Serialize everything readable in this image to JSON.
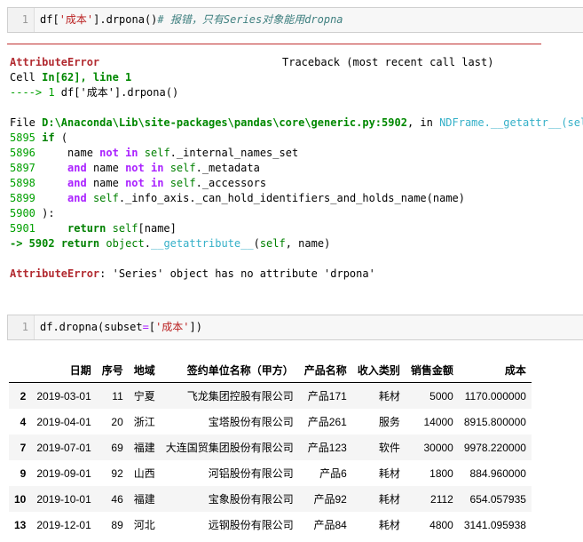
{
  "cell1": {
    "line_number": "1",
    "code_prefix": "df[",
    "code_string": "'成本'",
    "code_call": "].drpona()",
    "code_comment": "# 报错，只有Series对象能用dropna"
  },
  "traceback": {
    "error_name": "AttributeError",
    "traceback_header": "Traceback (most recent call last)",
    "cell_label": "Cell ",
    "cell_ref": "In[62], line 1",
    "arrow_line": "----> 1",
    "arrow_code": " df['成本'].drpona()",
    "file_prefix": "File ",
    "file_path": "D:\\Anaconda\\Lib\\site-packages\\pandas\\core\\generic.py:5902",
    "file_in": ", in ",
    "file_func": "NDFrame.__getattr__(self, name)",
    "lines": [
      {
        "num": "5895",
        "text": " if ("
      },
      {
        "num": "5896",
        "text": "     name not in self._internal_names_set"
      },
      {
        "num": "5897",
        "text": "     and name not in self._metadata"
      },
      {
        "num": "5898",
        "text": "     and name not in self._accessors"
      },
      {
        "num": "5899",
        "text": "     and self._info_axis._can_hold_identifiers_and_holds_name(name)"
      },
      {
        "num": "5900",
        "text": " ):"
      },
      {
        "num": "5901",
        "text": "     return self[name]"
      }
    ],
    "current_arrow": "-> 5902",
    "current_code": " return object.__getattribute__(self, name)",
    "final_error": "AttributeError",
    "final_message": ": 'Series' object has no attribute 'drpona'"
  },
  "cell2": {
    "line_number": "1",
    "code_prefix": "df.dropna(subset",
    "code_eq": "=",
    "code_rest_open": "[",
    "code_string": "'成本'",
    "code_rest_close": "])"
  },
  "table": {
    "columns": [
      "",
      "日期",
      "序号",
      "地域",
      "签约单位名称（甲方）",
      "产品名称",
      "收入类别",
      "销售金额",
      "成本"
    ],
    "rows": [
      [
        "2",
        "2019-03-01",
        "11",
        "宁夏",
        "飞龙集团控股有限公司",
        "产品171",
        "耗材",
        "5000",
        "1170.000000"
      ],
      [
        "4",
        "2019-04-01",
        "20",
        "浙江",
        "宝塔股份有限公司",
        "产品261",
        "服务",
        "14000",
        "8915.800000"
      ],
      [
        "7",
        "2019-07-01",
        "69",
        "福建",
        "大连国贸集团股份有限公司",
        "产品123",
        "软件",
        "30000",
        "9978.220000"
      ],
      [
        "9",
        "2019-09-01",
        "92",
        "山西",
        "河铝股份有限公司",
        "产品6",
        "耗材",
        "1800",
        "884.960000"
      ],
      [
        "10",
        "2019-10-01",
        "46",
        "福建",
        "宝象股份有限公司",
        "产品92",
        "耗材",
        "2112",
        "654.057935"
      ],
      [
        "13",
        "2019-12-01",
        "89",
        "河北",
        "远钢股份有限公司",
        "产品84",
        "耗材",
        "4800",
        "3141.095938"
      ]
    ]
  }
}
